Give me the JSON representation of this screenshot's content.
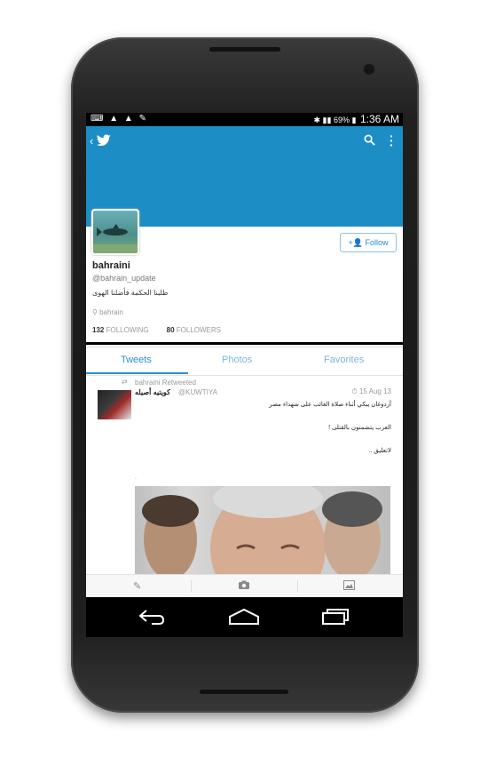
{
  "status_bar": {
    "left_icons": "⌨ ▲ ▲ ✎",
    "battery": "69%",
    "time": "1:36 AM"
  },
  "profile": {
    "name": "bahraini",
    "handle": "@bahrain_update",
    "bio": "طلبنا الحكمة فأضلنا الهوى",
    "location": "bahrain",
    "following_count": "132",
    "following_label": "FOLLOWING",
    "followers_count": "80",
    "followers_label": "FOLLOWERS",
    "follow_label": "Follow"
  },
  "tabs": [
    {
      "label": "Tweets"
    },
    {
      "label": "Photos"
    },
    {
      "label": "Favorites"
    }
  ],
  "tweet": {
    "retweet_label": "bahraini Retweeted",
    "author_name": "كويتيه أصيله",
    "author_handle": "@KUWTIYA",
    "time": "15 Aug 13",
    "lines": [
      "أردوغان يبكي أثناء صلاة الغائب على شهداء مصر",
      "العرب يتشمتون بالقتلى !",
      "لاتعليق .."
    ],
    "dot": "."
  },
  "colors": {
    "header": "#1d8dc6",
    "accent": "#2a8ec8"
  },
  "icons": {
    "back": "chevron-left-icon",
    "logo": "twitter-bird-icon",
    "search": "search-icon",
    "more": "more-vertical-icon",
    "compose": "compose-icon",
    "camera": "camera-icon",
    "gallery": "image-icon"
  }
}
